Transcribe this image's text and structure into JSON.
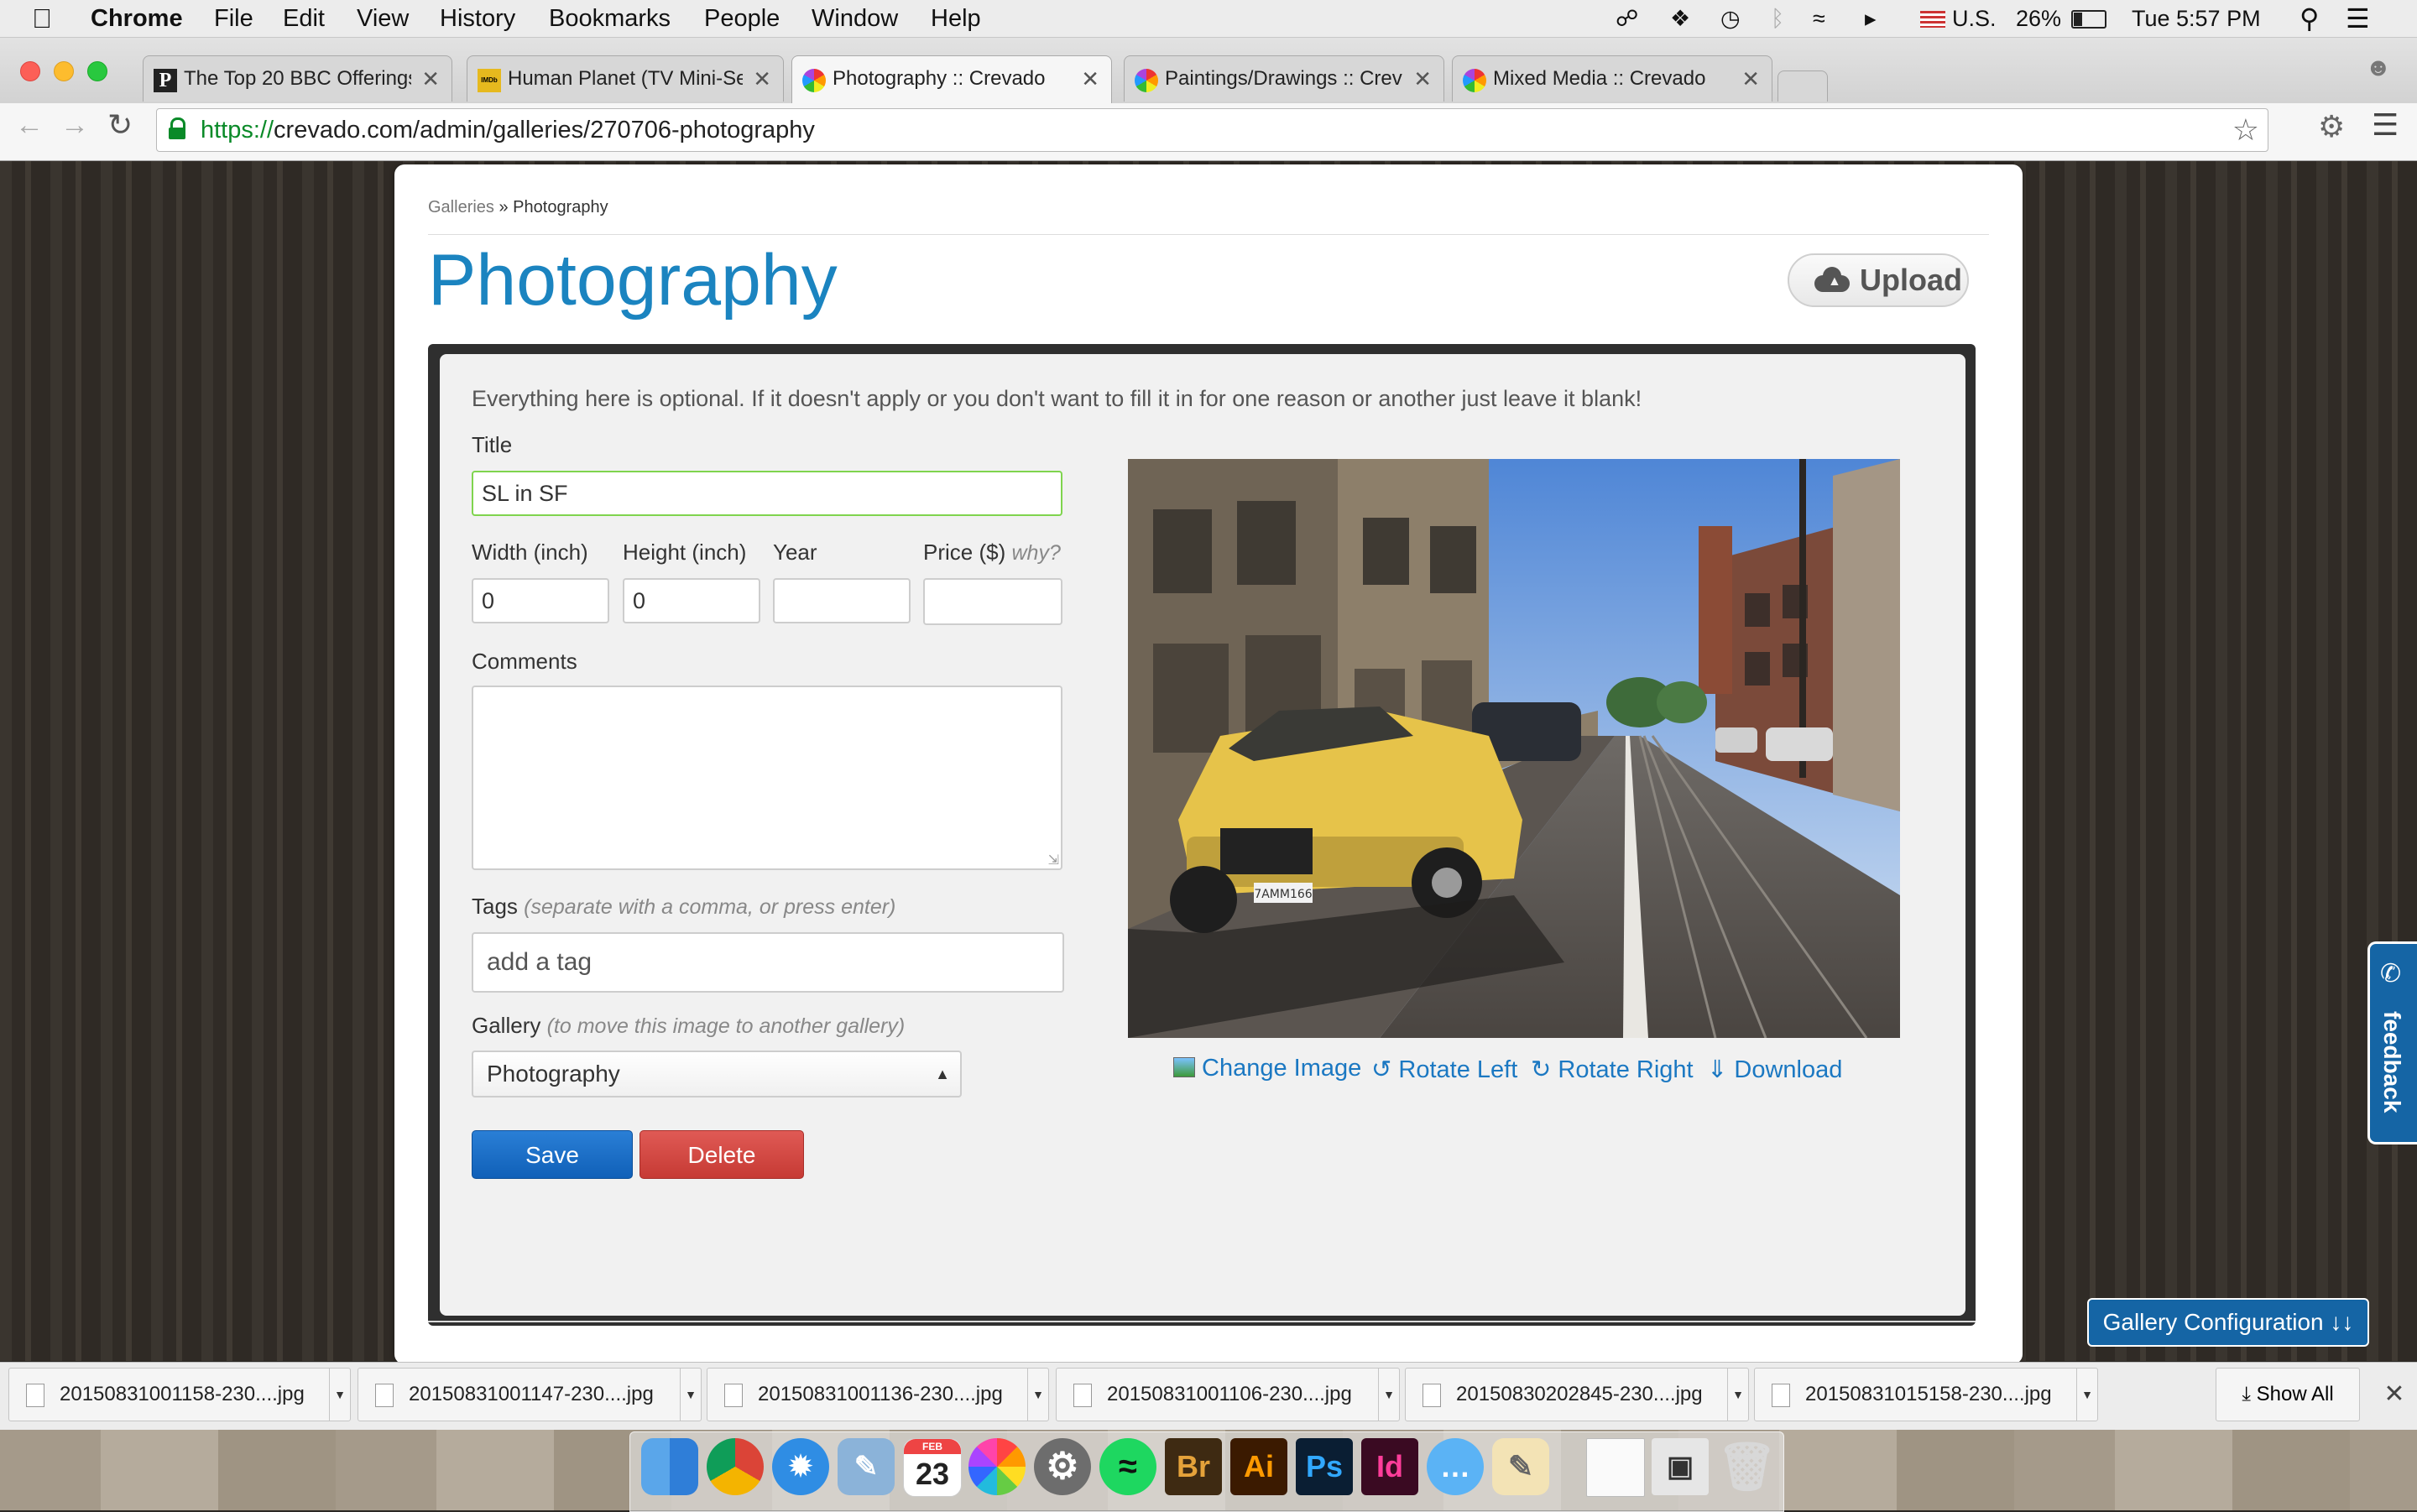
{
  "menubar": {
    "app": "Chrome",
    "items": [
      "File",
      "Edit",
      "View",
      "History",
      "Bookmarks",
      "People",
      "Window",
      "Help"
    ],
    "status": {
      "input_source": "U.S.",
      "battery": "26%",
      "clock": "Tue 5:57 PM"
    }
  },
  "tabs": [
    {
      "title": "The Top 20 BBC Offerings",
      "favicon": "P"
    },
    {
      "title": "Human Planet (TV Mini-Ser",
      "favicon": "IMDb"
    },
    {
      "title": "Photography :: Crevado",
      "favicon": "crevado-flower"
    },
    {
      "title": "Paintings/Drawings :: Crev",
      "favicon": "crevado-flower"
    },
    {
      "title": "Mixed Media :: Crevado",
      "favicon": "crevado-flower"
    }
  ],
  "address_bar": {
    "scheme": "https://",
    "rest": "crevado.com/admin/galleries/270706-photography"
  },
  "breadcrumb": {
    "link": "Galleries",
    "separator": " » ",
    "current": "Photography"
  },
  "page": {
    "title": "Photography",
    "upload_label": "Upload",
    "intro": "Everything here is optional. If it doesn't apply or you don't want to fill it in for one reason or another just leave it blank!"
  },
  "form": {
    "title_label": "Title",
    "title_value": "SL in SF",
    "width_label": "Width (inch)",
    "width_value": "0",
    "height_label": "Height (inch)",
    "height_value": "0",
    "year_label": "Year",
    "year_value": "",
    "price_label": "Price ($)",
    "price_hint": "why?",
    "price_value": "",
    "comments_label": "Comments",
    "tags_label": "Tags",
    "tags_hint": "(separate with a comma, or press enter)",
    "tags_placeholder": "add a tag",
    "gallery_label": "Gallery",
    "gallery_hint": "(to move this image to another gallery)",
    "gallery_selected": "Photography",
    "save_label": "Save",
    "delete_label": "Delete"
  },
  "image_actions": {
    "change": "Change Image",
    "rotate_left": "Rotate Left",
    "rotate_right": "Rotate Right",
    "download": "Download"
  },
  "photo_plate": "7AMM166",
  "feedback_label": "feedback",
  "gallery_config_label": "Gallery Configuration ↓↓",
  "downloads": [
    "20150831001158-230....jpg",
    "20150831001147-230....jpg",
    "20150831001136-230....jpg",
    "20150831001106-230....jpg",
    "20150830202845-230....jpg",
    "20150831015158-230....jpg"
  ],
  "show_all_label": "Show All",
  "dock": {
    "calendar_month": "FEB",
    "calendar_day": "23",
    "apps": [
      "Finder",
      "Chrome",
      "Safari",
      "Preview",
      "Calendar",
      "Photos",
      "System Preferences",
      "Spotify",
      "Br",
      "Ai",
      "Ps",
      "Id",
      "Messages",
      "TextEdit",
      "Document",
      "Screenshot",
      "Trash"
    ]
  },
  "colors": {
    "accent": "#1b84c0",
    "save": "#1a6fc8",
    "delete": "#d2463f",
    "feedback": "#1565a5"
  }
}
